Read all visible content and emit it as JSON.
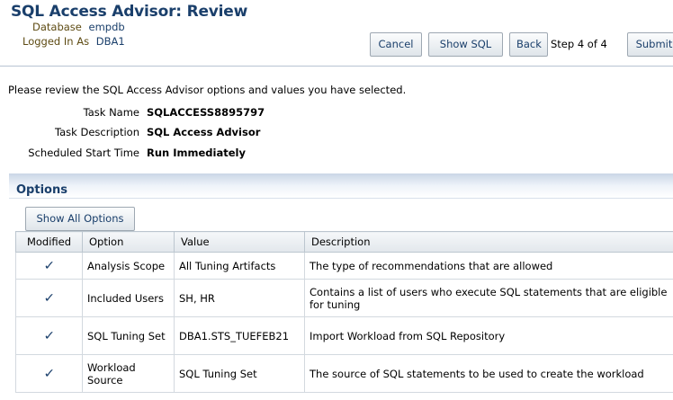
{
  "header": {
    "title": "SQL Access Advisor: Review",
    "database_label": "Database",
    "database_value": "empdb",
    "logged_in_label": "Logged In As",
    "logged_in_value": "DBA1"
  },
  "toolbar": {
    "cancel_label": "Cancel",
    "show_sql_label": "Show SQL",
    "back_label": "Back",
    "step_text": "Step 4 of 4",
    "submit_label": "Submit"
  },
  "intro": "Please review the SQL Access Advisor options and values you have selected.",
  "summary": {
    "task_name_label": "Task Name",
    "task_name_value": "SQLACCESS8895797",
    "task_description_label": "Task Description",
    "task_description_value": "SQL Access Advisor",
    "start_time_label": "Scheduled Start Time",
    "start_time_value": "Run Immediately"
  },
  "options": {
    "section_title": "Options",
    "show_all_label": "Show All Options",
    "columns": [
      "Modified",
      "Option",
      "Value",
      "Description"
    ],
    "rows": [
      {
        "modified": "✓",
        "option": "Analysis Scope",
        "value": "All Tuning Artifacts",
        "description": "The type of recommendations that are allowed"
      },
      {
        "modified": "✓",
        "option": "Included Users",
        "value": "SH, HR",
        "description": "Contains a list of users who execute SQL statements that are eligible for tuning"
      },
      {
        "modified": "✓",
        "option": "SQL Tuning Set",
        "value": "DBA1.STS_TUEFEB21",
        "description": "Import Workload from SQL Repository"
      },
      {
        "modified": "✓",
        "option": "Workload Source",
        "value": "SQL Tuning Set",
        "description": "The source of SQL statements to be used to create the workload"
      }
    ]
  },
  "colors": {
    "title_blue": "#1a3f6b",
    "label_brown": "#5e4b13",
    "band_blue": "#cad6e6"
  }
}
